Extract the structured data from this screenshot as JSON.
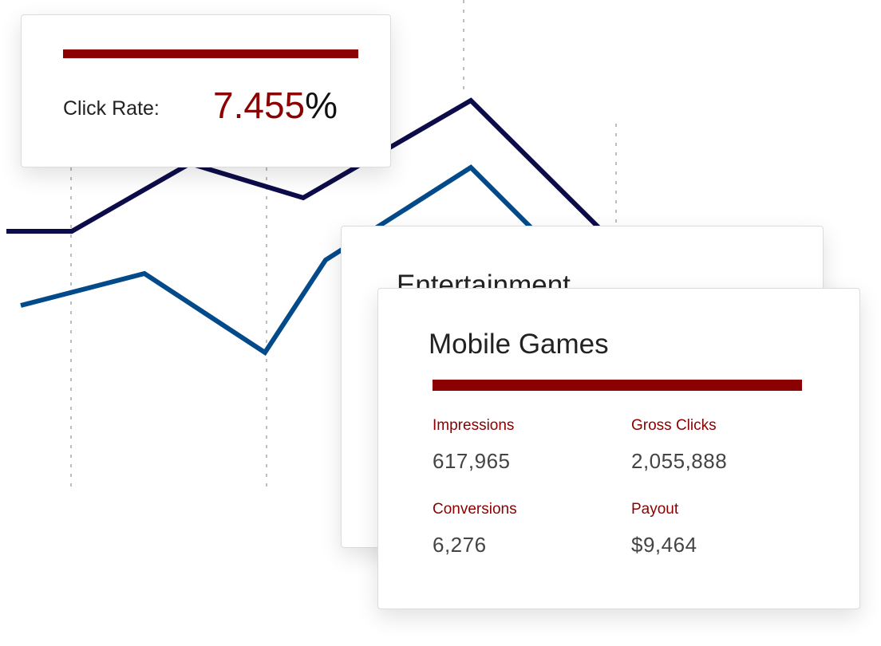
{
  "colors": {
    "accent": "#8b0000",
    "series_dark": "#0d0c4a",
    "series_blue": "#034a8a",
    "gridline": "#bdbdbd"
  },
  "click_rate_card": {
    "label": "Click Rate:",
    "value": "7.455",
    "unit": "%"
  },
  "entertainment_card": {
    "title": "Entertainment"
  },
  "mobile_games_card": {
    "title": "Mobile Games",
    "stats": [
      {
        "label": "Impressions",
        "value": "617,965"
      },
      {
        "label": "Gross Clicks",
        "value": "2,055,888"
      },
      {
        "label": "Conversions",
        "value": "6,276"
      },
      {
        "label": "Payout",
        "value": "$9,464"
      }
    ]
  }
}
